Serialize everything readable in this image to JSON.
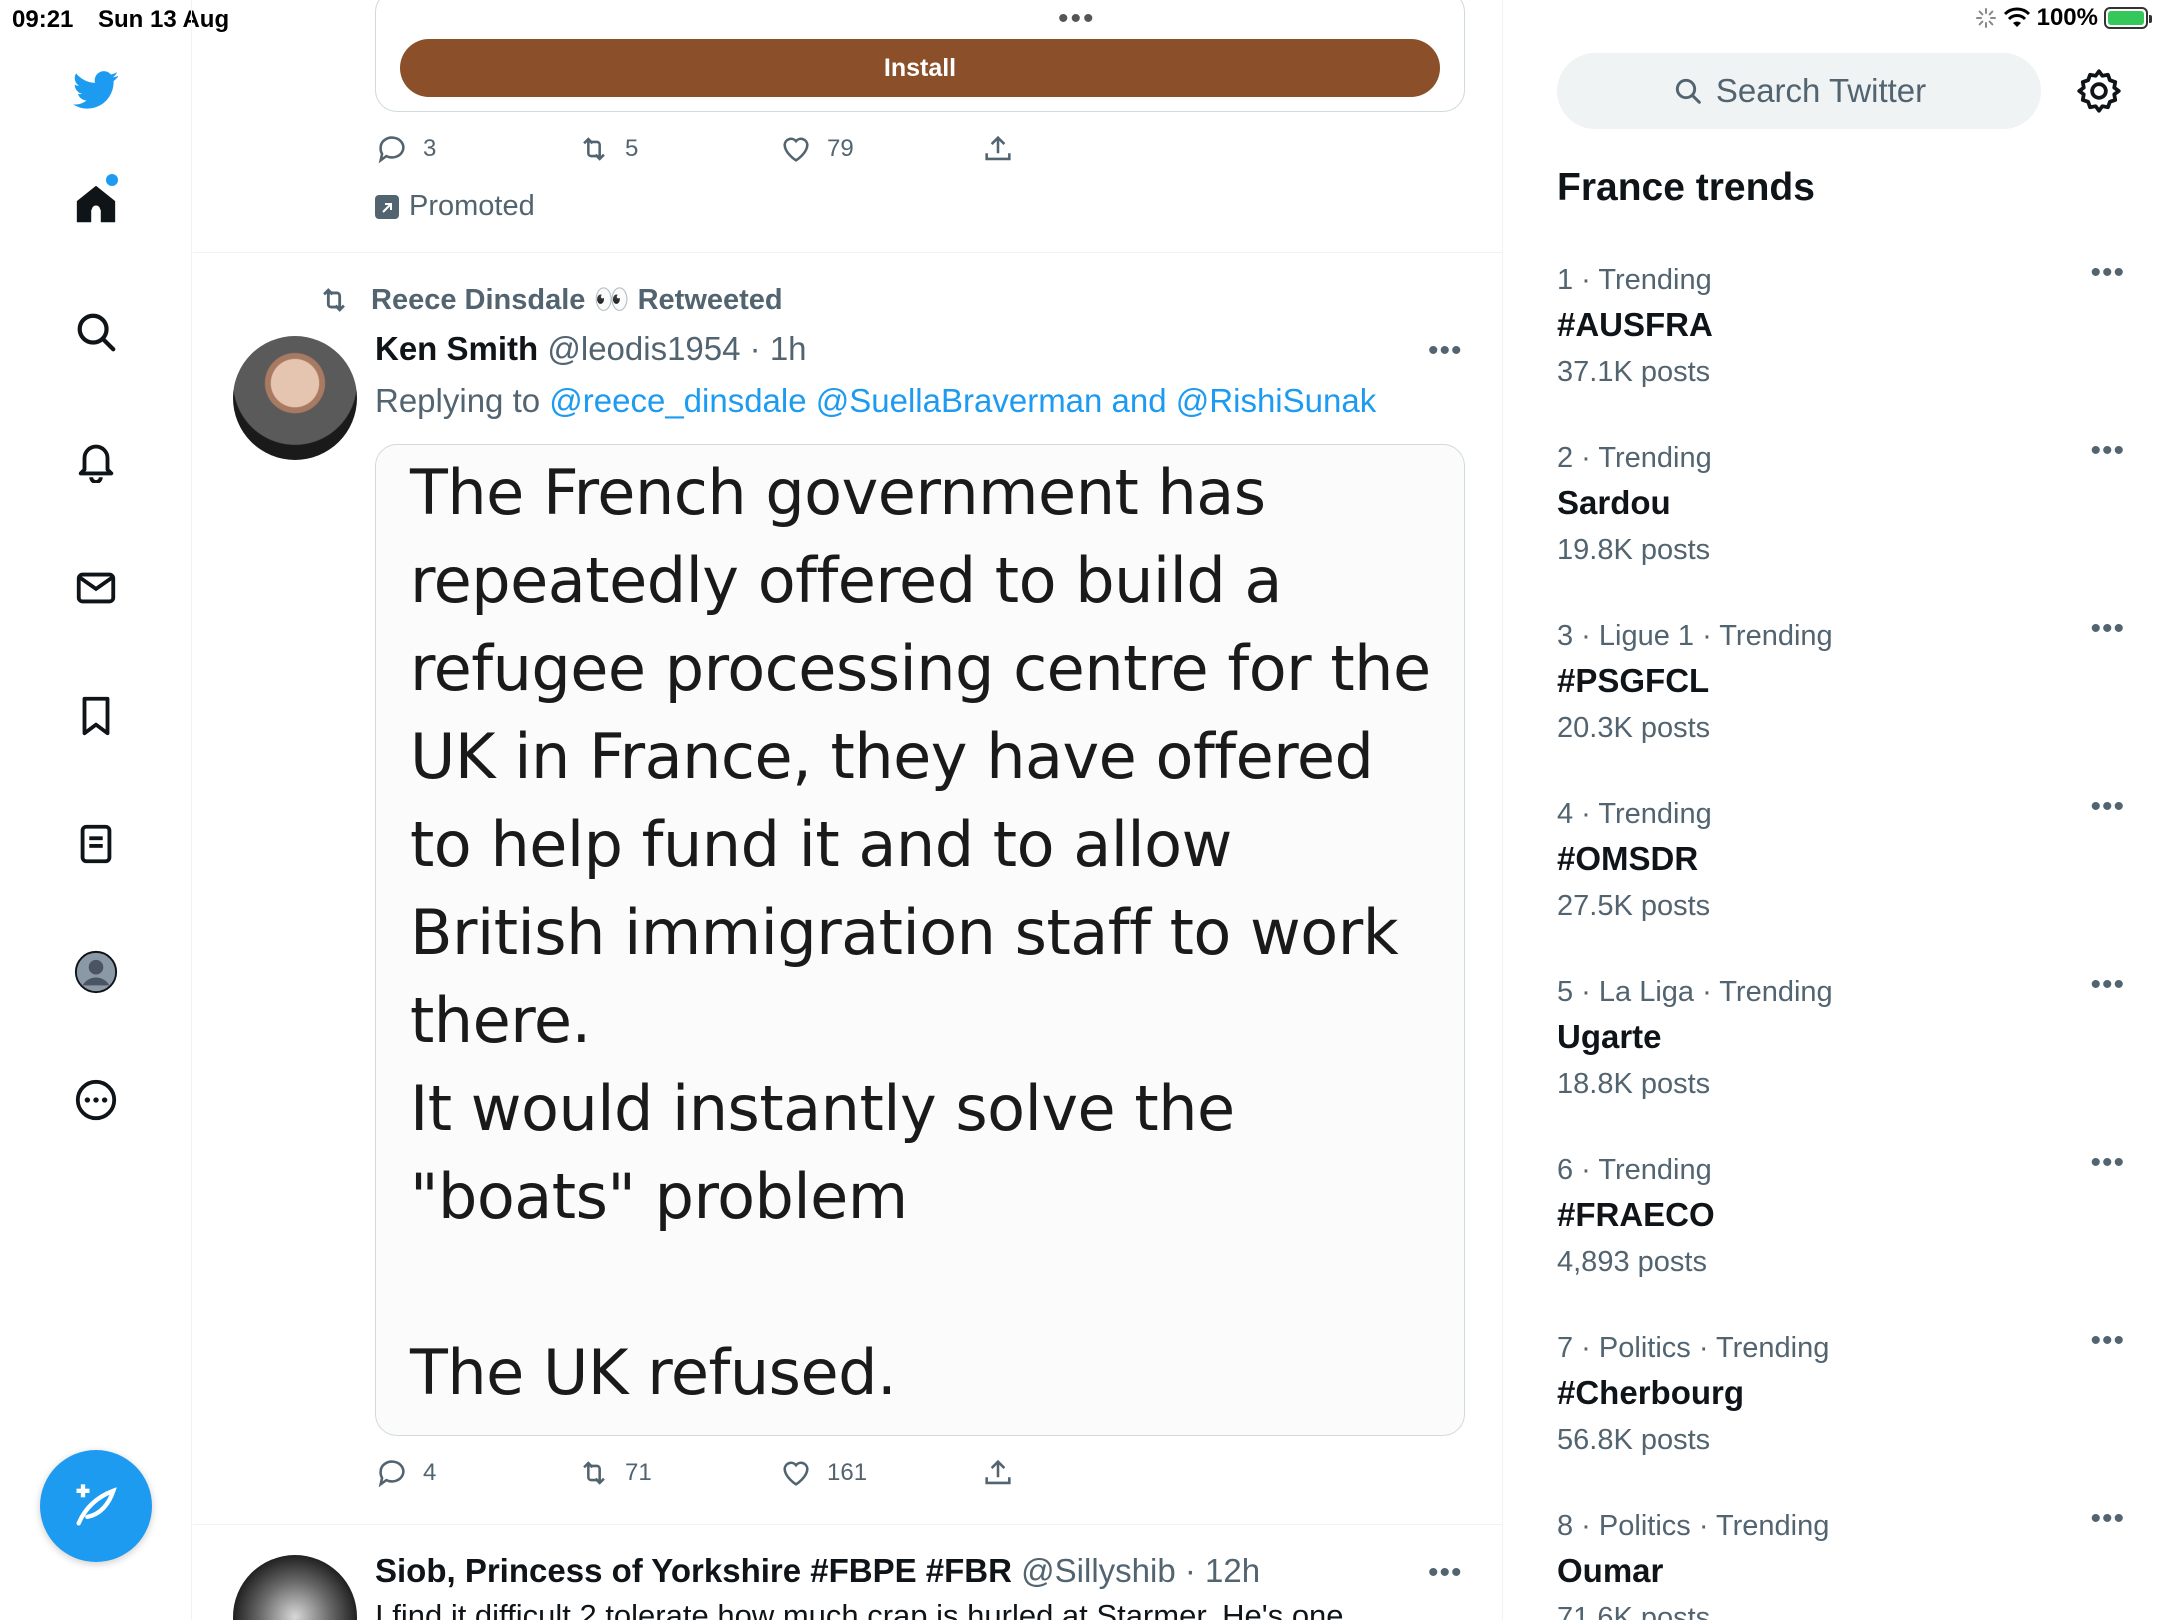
{
  "status_bar": {
    "time": "09:21",
    "date": "Sun 13 Aug",
    "battery": "100%"
  },
  "nav": {
    "items": [
      "twitter-logo",
      "home",
      "explore",
      "notifications",
      "messages",
      "bookmarks",
      "lists",
      "profile",
      "more"
    ]
  },
  "promo": {
    "install_label": "Install",
    "replies": "3",
    "retweets": "5",
    "likes": "79",
    "promoted_label": "Promoted"
  },
  "tweet": {
    "retweeted_by": "Reece Dinsdale 👀 Retweeted",
    "author_name": "Ken Smith",
    "author_meta": "@leodis1954 · 1h",
    "replying_prefix": "Replying to ",
    "replying_mentions": "@reece_dinsdale @SuellaBraverman and @RishiSunak",
    "image_text": "The French government has\nrepeatedly offered to build a\nrefugee processing centre for the\nUK in France, they have offered\nto help fund it and to allow\nBritish immigration staff to work\nthere.\nIt would instantly solve the\n\"boats\" problem\n\nThe UK refused.",
    "replies": "4",
    "retweets": "71",
    "likes": "161"
  },
  "tweet3": {
    "author_name": "Siob, Princess of Yorkshire #FBPE #FBR",
    "author_meta": "@Sillyshib · 12h",
    "body": "I find it difficult 2 tolerate how much crap is hurled at Starmer. He's one"
  },
  "sidebar": {
    "search_placeholder": "Search Twitter",
    "trends_title": "France trends",
    "trends": [
      {
        "context": "1 · Trending",
        "name": "#AUSFRA",
        "posts": "37.1K posts"
      },
      {
        "context": "2 · Trending",
        "name": "Sardou",
        "posts": "19.8K posts"
      },
      {
        "context": "3 · Ligue 1 · Trending",
        "name": "#PSGFCL",
        "posts": "20.3K posts"
      },
      {
        "context": "4 · Trending",
        "name": "#OMSDR",
        "posts": "27.5K posts"
      },
      {
        "context": "5 · La Liga · Trending",
        "name": "Ugarte",
        "posts": "18.8K posts"
      },
      {
        "context": "6 · Trending",
        "name": "#FRAECO",
        "posts": "4,893 posts"
      },
      {
        "context": "7 · Politics · Trending",
        "name": "#Cherbourg",
        "posts": "56.8K posts"
      },
      {
        "context": "8 · Politics · Trending",
        "name": "Oumar",
        "posts": "71.6K posts"
      }
    ]
  },
  "colors": {
    "accent": "#1d9bf0",
    "install_button": "#8b4f2a",
    "secondary_text": "#536471"
  }
}
